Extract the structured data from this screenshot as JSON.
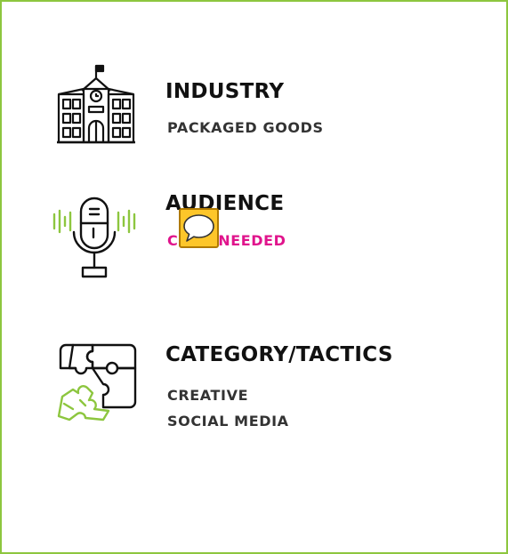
{
  "sections": [
    {
      "title": "INDUSTRY",
      "lines": [
        "PACKAGED GOODS"
      ],
      "icon": "school-building-icon"
    },
    {
      "title": "AUDIENCE",
      "lines": [
        "COPY NEEDED"
      ],
      "icon": "microphone-icon"
    },
    {
      "title": "CATEGORY/TACTICS",
      "lines": [
        "CREATIVE",
        "SOCIAL MEDIA"
      ],
      "icon": "puzzle-icon"
    }
  ],
  "comment": {
    "icon": "speech-bubble-icon"
  },
  "colors": {
    "border": "#8dc63f",
    "accent_green": "#8dc63f",
    "accent_pink": "#e0148c",
    "comment_badge": "#fdc62a"
  }
}
